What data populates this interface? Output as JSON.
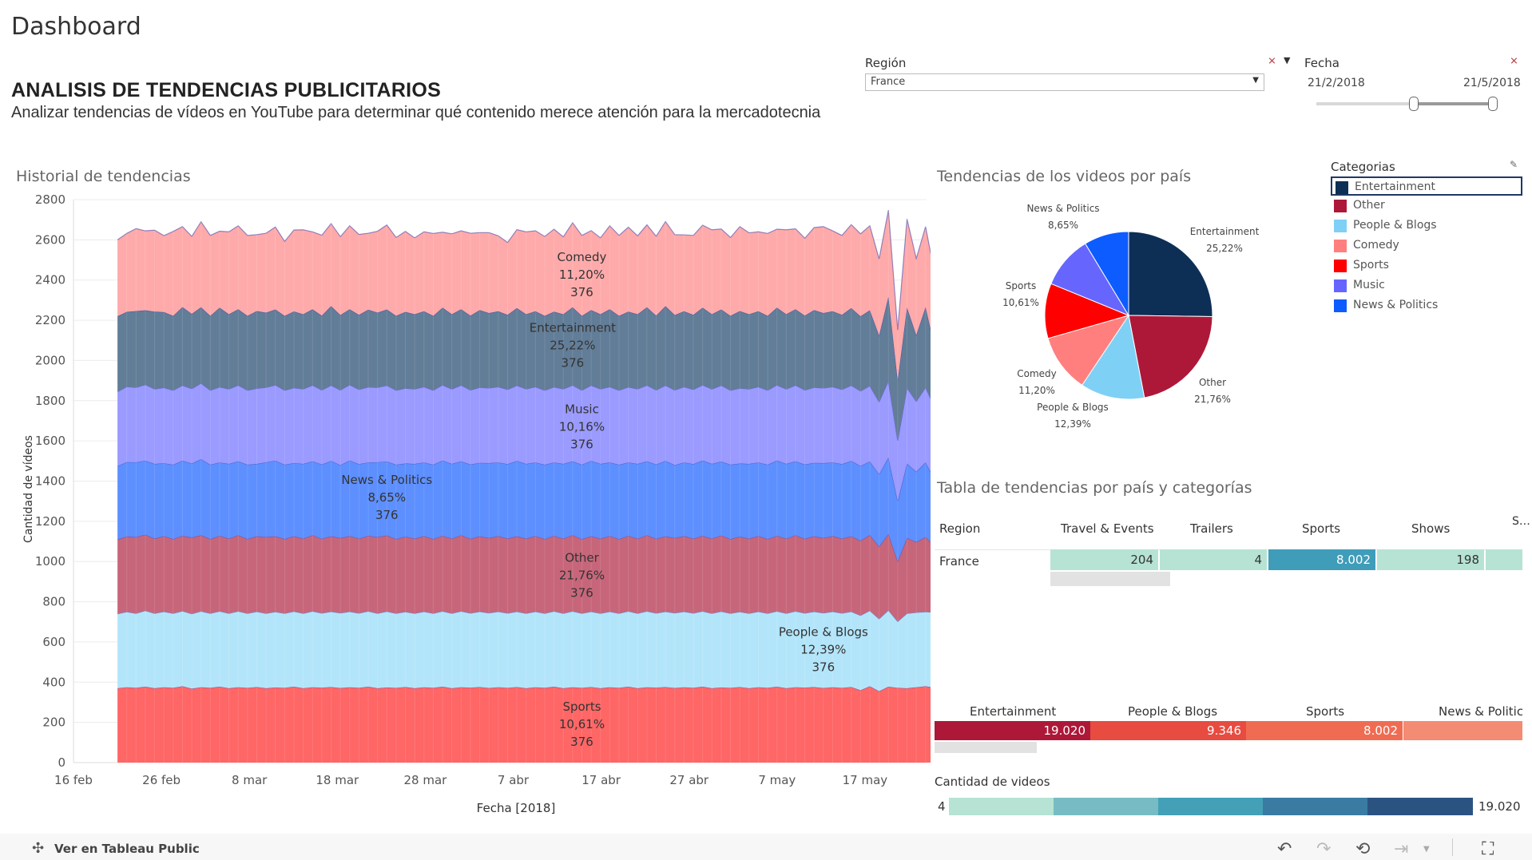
{
  "page": {
    "dashboard_title": "Dashboard",
    "main_title": "ANALISIS DE TENDENCIAS PUBLICITARIOS",
    "subtitle": "Analizar tendencias de vídeos en YouTube para determinar qué contenido merece atención para la mercadotecnia"
  },
  "filters": {
    "region_label": "Región",
    "region_value": "France",
    "date_label": "Fecha",
    "date_start": "21/2/2018",
    "date_end": "21/5/2018",
    "date_range_fraction": [
      0.55,
      1.0
    ]
  },
  "area_chart": {
    "title": "Historial de tendencias",
    "xlabel": "Fecha [2018]",
    "ylabel": "Cantidad de vídeos",
    "y_ticks": [
      "2800",
      "2600",
      "2400",
      "2200",
      "2000",
      "1800",
      "1600",
      "1400",
      "1200",
      "1000",
      "800",
      "600",
      "400",
      "200",
      "0"
    ],
    "x_ticks": [
      "16 feb",
      "26 feb",
      "8 mar",
      "18 mar",
      "28 mar",
      "7 abr",
      "17 abr",
      "27 abr",
      "7 may",
      "17 may"
    ]
  },
  "chart_data": {
    "type": "area",
    "title": "Historial de tendencias",
    "xlabel": "Fecha [2018]",
    "ylabel": "Cantidad de vídeos",
    "ylim": [
      0,
      2800
    ],
    "x_range": [
      "2018-02-16",
      "2018-05-24"
    ],
    "series": [
      {
        "name": "Sports",
        "percent": "10,61%",
        "days": "376",
        "values": [
          370,
          375,
          372,
          378,
          370,
          375,
          372,
          380,
          368,
          375,
          372,
          378,
          370,
          375,
          372,
          376,
          370,
          374,
          372,
          378,
          370,
          375,
          373,
          376,
          371,
          375,
          372,
          378,
          370,
          374,
          372,
          376,
          370,
          375,
          372,
          378,
          370,
          375,
          373,
          376,
          371,
          375,
          372,
          376,
          370,
          375,
          372,
          378,
          370,
          375,
          372,
          376,
          370,
          375,
          372,
          378,
          370,
          375,
          373,
          376,
          371,
          375,
          372,
          378,
          370,
          374,
          372,
          376,
          370,
          375,
          372,
          378,
          370,
          375,
          373,
          376,
          371,
          375,
          372,
          376,
          360,
          380,
          355,
          378,
          372,
          370,
          375,
          380,
          372,
          376
        ]
      },
      {
        "name": "People & Blogs",
        "percent": "12,39%",
        "days": "376",
        "values": [
          370,
          375,
          370,
          378,
          372,
          376,
          370,
          374,
          372,
          378,
          370,
          375,
          372,
          378,
          370,
          375,
          372,
          376,
          370,
          374,
          372,
          378,
          370,
          375,
          373,
          376,
          371,
          375,
          372,
          378,
          370,
          374,
          372,
          376,
          370,
          375,
          372,
          378,
          370,
          375,
          373,
          376,
          371,
          375,
          372,
          376,
          370,
          375,
          372,
          378,
          370,
          375,
          372,
          376,
          370,
          375,
          372,
          378,
          370,
          375,
          373,
          376,
          371,
          375,
          372,
          378,
          370,
          374,
          372,
          376,
          370,
          375,
          372,
          378,
          370,
          375,
          373,
          376,
          371,
          375,
          372,
          376,
          360,
          380,
          330,
          372,
          372,
          370,
          375,
          372
        ]
      },
      {
        "name": "Other",
        "percent": "21,76%",
        "days": "376",
        "values": [
          370,
          375,
          380,
          378,
          372,
          376,
          370,
          374,
          380,
          378,
          370,
          375,
          372,
          378,
          370,
          375,
          380,
          376,
          370,
          374,
          372,
          378,
          370,
          375,
          373,
          376,
          371,
          375,
          380,
          378,
          370,
          374,
          372,
          376,
          370,
          375,
          372,
          378,
          370,
          375,
          373,
          376,
          371,
          375,
          372,
          376,
          370,
          375,
          372,
          378,
          370,
          375,
          372,
          376,
          370,
          375,
          372,
          378,
          370,
          375,
          373,
          376,
          371,
          375,
          372,
          378,
          370,
          374,
          372,
          376,
          370,
          375,
          372,
          378,
          370,
          375,
          373,
          376,
          371,
          375,
          372,
          376,
          360,
          380,
          300,
          376,
          350,
          372,
          330,
          372
        ]
      },
      {
        "name": "News & Politics",
        "percent": "8,65%",
        "days": "376",
        "values": [
          365,
          370,
          372,
          368,
          372,
          362,
          370,
          374,
          368,
          378,
          370,
          365,
          372,
          368,
          370,
          360,
          372,
          376,
          370,
          364,
          372,
          368,
          370,
          375,
          363,
          376,
          371,
          365,
          372,
          368,
          370,
          364,
          372,
          366,
          370,
          375,
          372,
          368,
          370,
          365,
          373,
          366,
          371,
          375,
          372,
          366,
          370,
          365,
          372,
          368,
          370,
          375,
          372,
          366,
          370,
          365,
          372,
          368,
          370,
          375,
          363,
          366,
          371,
          375,
          372,
          368,
          370,
          364,
          372,
          366,
          370,
          375,
          372,
          368,
          370,
          365,
          373,
          366,
          371,
          375,
          372,
          366,
          360,
          380,
          300,
          370,
          350,
          372,
          330,
          372
        ]
      },
      {
        "name": "Music",
        "percent": "10,16%",
        "days": "376",
        "values": [
          370,
          375,
          372,
          378,
          372,
          376,
          370,
          374,
          372,
          378,
          370,
          375,
          372,
          378,
          370,
          375,
          372,
          376,
          370,
          374,
          372,
          378,
          370,
          375,
          373,
          376,
          371,
          375,
          372,
          378,
          370,
          374,
          372,
          376,
          370,
          375,
          372,
          378,
          370,
          375,
          373,
          376,
          371,
          375,
          372,
          376,
          370,
          375,
          372,
          378,
          370,
          375,
          372,
          376,
          370,
          375,
          372,
          378,
          370,
          375,
          373,
          376,
          371,
          375,
          372,
          378,
          370,
          374,
          372,
          376,
          370,
          375,
          372,
          378,
          370,
          375,
          373,
          376,
          371,
          375,
          372,
          376,
          360,
          380,
          300,
          376,
          350,
          372,
          360,
          372
        ]
      },
      {
        "name": "Entertainment",
        "percent": "25,22%",
        "days": "376",
        "values": [
          375,
          372,
          380,
          370,
          385,
          376,
          370,
          390,
          372,
          378,
          370,
          395,
          372,
          378,
          370,
          385,
          372,
          376,
          370,
          380,
          372,
          378,
          370,
          395,
          373,
          376,
          371,
          385,
          372,
          378,
          370,
          380,
          372,
          376,
          370,
          385,
          372,
          378,
          370,
          385,
          373,
          376,
          371,
          385,
          372,
          376,
          370,
          375,
          372,
          388,
          370,
          375,
          372,
          386,
          370,
          375,
          372,
          388,
          370,
          395,
          373,
          376,
          371,
          385,
          372,
          378,
          370,
          384,
          372,
          376,
          370,
          385,
          372,
          378,
          370,
          385,
          373,
          376,
          371,
          385,
          372,
          376,
          330,
          420,
          300,
          400,
          330,
          400,
          300,
          380
        ]
      },
      {
        "name": "Comedy",
        "percent": "11,20%",
        "days": "376",
        "values": [
          380,
          390,
          410,
          395,
          405,
          380,
          420,
          400,
          385,
          425,
          400,
          380,
          410,
          415,
          400,
          380,
          395,
          410,
          370,
          405,
          420,
          385,
          400,
          410,
          390,
          415,
          400,
          380,
          405,
          420,
          390,
          400,
          380,
          395,
          410,
          375,
          400,
          390,
          410,
          385,
          400,
          375,
          360,
          390,
          410,
          400,
          395,
          410,
          385,
          420,
          400,
          395,
          380,
          415,
          400,
          420,
          390,
          410,
          395,
          420,
          400,
          380,
          395,
          410,
          420,
          400,
          390,
          420,
          405,
          395,
          410,
          390,
          420,
          400,
          385,
          410,
          430,
          400,
          395,
          415,
          410,
          420,
          380,
          430,
          250,
          440,
          380,
          400,
          360,
          420
        ]
      }
    ],
    "pie": {
      "title": "Tendencias de los videos por país",
      "slices": [
        {
          "name": "Entertainment",
          "percent": 25.22,
          "label": "25,22%"
        },
        {
          "name": "Other",
          "percent": 21.76,
          "label": "21,76%"
        },
        {
          "name": "People & Blogs",
          "percent": 12.39,
          "label": "12,39%"
        },
        {
          "name": "Comedy",
          "percent": 11.2,
          "label": "11,20%"
        },
        {
          "name": "Sports",
          "percent": 10.61,
          "label": "10,61%"
        },
        {
          "name": "Music",
          "percent": 10.16,
          "label": ""
        },
        {
          "name": "News & Politics",
          "percent": 8.65,
          "label": "8,65%"
        }
      ]
    },
    "table": {
      "title": "Tabla de tendencias por país y categorías",
      "columns": [
        "Region",
        "Travel & Events",
        "Trailers",
        "Sports",
        "Shows",
        "S…"
      ],
      "rows": [
        {
          "region": "France",
          "values": [
            "204",
            "4",
            "8.002",
            "198"
          ],
          "numeric": [
            204,
            4,
            8002,
            198
          ]
        }
      ]
    },
    "category_bars": {
      "categories": [
        "Entertainment",
        "People & Blogs",
        "Sports",
        "News & Politics"
      ],
      "labels": [
        "19.020",
        "9.346",
        "8.002",
        ""
      ],
      "values": [
        19020,
        9346,
        8002,
        null
      ]
    },
    "color_legend": {
      "title": "Cantidad de videos",
      "min": "4",
      "max": "19.020"
    }
  },
  "legend": {
    "title": "Categorias",
    "items": [
      {
        "name": "Entertainment",
        "color": "#0e2f55"
      },
      {
        "name": "Other",
        "color": "#ad1839"
      },
      {
        "name": "People & Blogs",
        "color": "#7fd0f5"
      },
      {
        "name": "Comedy",
        "color": "#ff7f7f"
      },
      {
        "name": "Sports",
        "color": "#ff0000"
      },
      {
        "name": "Music",
        "color": "#6666ff"
      },
      {
        "name": "News & Politics",
        "color": "#0d5cff"
      }
    ]
  },
  "area_colors": {
    "Sports": "#ff6666",
    "People & Blogs": "#b3e5fa",
    "Other": "#c7667a",
    "News & Politics": "#5d8fff",
    "Music": "#9a9aff",
    "Entertainment": "#627d97",
    "Comedy": "#ffaaaa"
  },
  "footer": {
    "link": "Ver en Tableau Public"
  }
}
